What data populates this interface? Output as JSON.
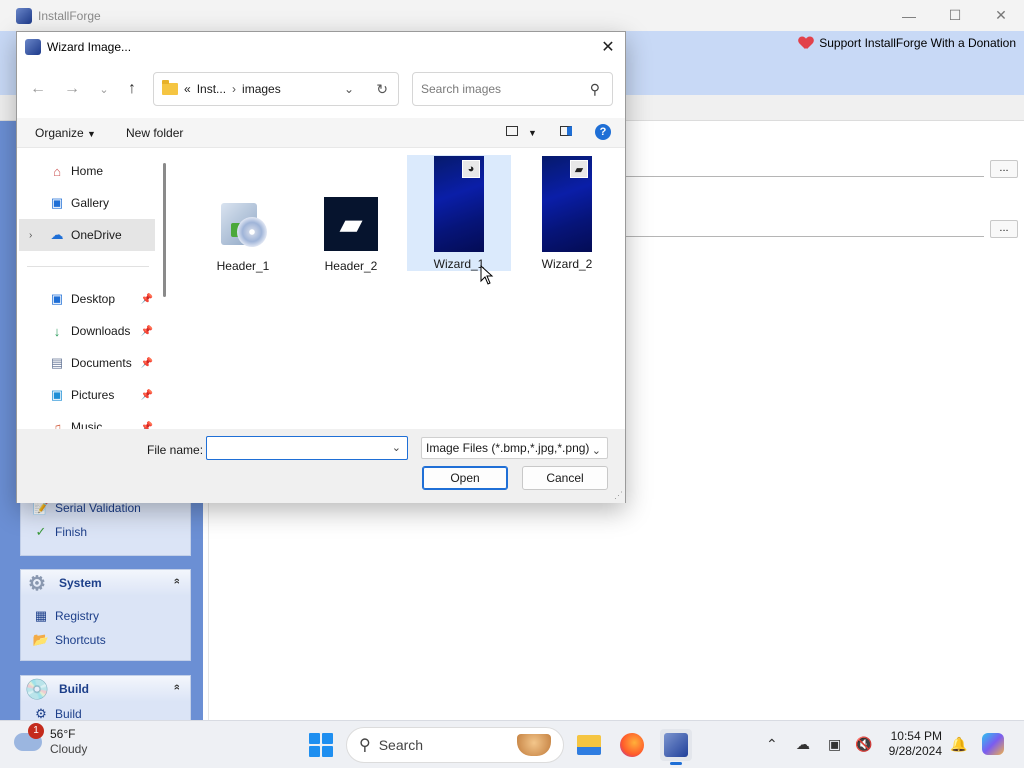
{
  "app": {
    "title": "InstallForge",
    "donate_text": "Support InstallForge With a Donation",
    "browse_label": "...",
    "panels": [
      {
        "items": [
          {
            "label": "Serial Validation",
            "icon": "serial-icon"
          },
          {
            "label": "Finish",
            "icon": "finish-icon"
          }
        ]
      },
      {
        "title": "System",
        "collapse": "»",
        "items": [
          {
            "label": "Registry",
            "icon": "registry-icon"
          },
          {
            "label": "Shortcuts",
            "icon": "shortcuts-icon"
          }
        ]
      },
      {
        "title": "Build",
        "collapse": "»",
        "items": [
          {
            "label": "Build",
            "icon": "build-icon"
          }
        ]
      }
    ]
  },
  "dialog": {
    "title": "Wizard Image...",
    "address": {
      "overflow": "«",
      "crumbs": [
        "Inst...",
        "images"
      ]
    },
    "search_placeholder": "Search images",
    "commands": {
      "organize": "Organize",
      "new_folder": "New folder"
    },
    "nav_items": [
      {
        "label": "Home",
        "icon": "home-icon",
        "selected": false
      },
      {
        "label": "Gallery",
        "icon": "gallery-icon",
        "selected": false
      },
      {
        "label": "OneDrive",
        "icon": "onedrive-icon",
        "selected": true
      },
      {
        "label": "Desktop",
        "icon": "desktop-icon",
        "pinned": true
      },
      {
        "label": "Downloads",
        "icon": "downloads-icon",
        "pinned": true
      },
      {
        "label": "Documents",
        "icon": "documents-icon",
        "pinned": true
      },
      {
        "label": "Pictures",
        "icon": "pictures-icon",
        "pinned": true
      },
      {
        "label": "Music",
        "icon": "music-icon",
        "pinned": true
      }
    ],
    "files": [
      {
        "name": "Header_1",
        "thumb": "installer-icon",
        "selected": false
      },
      {
        "name": "Header_2",
        "thumb": "header-dark-icon",
        "selected": false
      },
      {
        "name": "Wizard_1",
        "thumb": "wizard-blue-image",
        "selected": true
      },
      {
        "name": "Wizard_2",
        "thumb": "wizard-blue-image",
        "selected": false
      }
    ],
    "file_name_label": "File name:",
    "file_name_value": "",
    "filter": "Image Files (*.bmp,*.jpg,*.png)",
    "open_label": "Open",
    "cancel_label": "Cancel"
  },
  "taskbar": {
    "weather": {
      "temp": "56°F",
      "condition": "Cloudy",
      "badge": "1"
    },
    "search_label": "Search",
    "time": "10:54 PM",
    "date": "9/28/2024"
  },
  "colors": {
    "accent": "#1f6fd6",
    "left_pane": "#6b8fd4",
    "banner": "#c8d9f6",
    "panel_text": "#1d3f8a"
  }
}
